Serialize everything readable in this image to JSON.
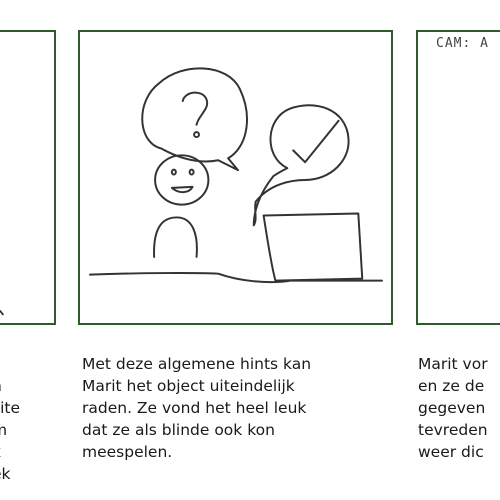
{
  "panels": {
    "left": {
      "caption_lines": [
        ":",
        "n",
        "site",
        "m",
        "k",
        "ek"
      ]
    },
    "middle": {
      "caption_lines": [
        "Met deze algemene hints kan",
        "Marit het object uiteindelijk",
        "raden. Ze vond het heel leuk",
        "dat ze als blinde ook kon",
        "meespelen."
      ]
    },
    "right": {
      "sketch_label": "CAM: A",
      "caption_lines": [
        "Marit vor",
        "en ze de",
        "gegeven",
        "tevreden",
        "weer dic"
      ]
    }
  },
  "colors": {
    "frame_border": "#2f5a2a",
    "text": "#1a1a1a",
    "sketch_stroke": "#333333"
  }
}
